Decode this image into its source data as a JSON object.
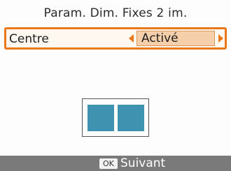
{
  "screen": {
    "title": "Param. Dim. Fixes 2 im."
  },
  "setting": {
    "label": "Centre",
    "value": "Activé"
  },
  "footer": {
    "ok_badge": "OK",
    "next_label": "Suivant"
  },
  "colors": {
    "accent": "#e87818",
    "value_background": "#f4cfa9",
    "photo_tile": "#3f93b0",
    "footer_bar": "#7a7a7a"
  }
}
